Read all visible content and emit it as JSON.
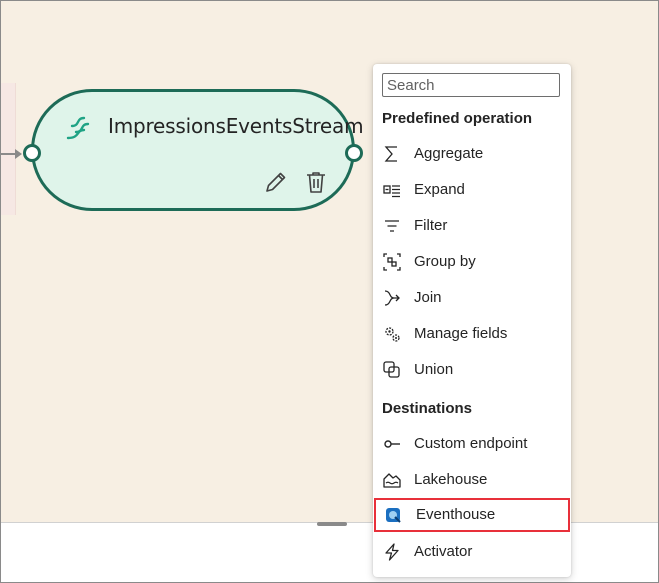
{
  "canvas": {
    "background": "#f7efe3",
    "node": {
      "title": "ImpressionsEventsStream",
      "icon": "eventstream-icon",
      "border_color": "#1d6b57",
      "fill_color": "#dff4ea",
      "actions": [
        "edit-pencil-icon",
        "delete-trash-icon"
      ]
    }
  },
  "menu": {
    "search_placeholder": "Search",
    "sections": [
      {
        "title": "Predefined operation",
        "items": [
          {
            "label": "Aggregate",
            "icon": "sigma-icon"
          },
          {
            "label": "Expand",
            "icon": "expand-icon"
          },
          {
            "label": "Filter",
            "icon": "filter-icon"
          },
          {
            "label": "Group by",
            "icon": "group-by-icon"
          },
          {
            "label": "Join",
            "icon": "join-icon"
          },
          {
            "label": "Manage fields",
            "icon": "gears-icon"
          },
          {
            "label": "Union",
            "icon": "union-icon"
          }
        ]
      },
      {
        "title": "Destinations",
        "items": [
          {
            "label": "Custom endpoint",
            "icon": "custom-endpoint-icon"
          },
          {
            "label": "Lakehouse",
            "icon": "lakehouse-icon"
          },
          {
            "label": "Eventhouse",
            "icon": "eventhouse-icon",
            "highlighted": true,
            "highlight_color": "#e8303a"
          },
          {
            "label": "Activator",
            "icon": "activator-bolt-icon"
          }
        ]
      }
    ]
  }
}
